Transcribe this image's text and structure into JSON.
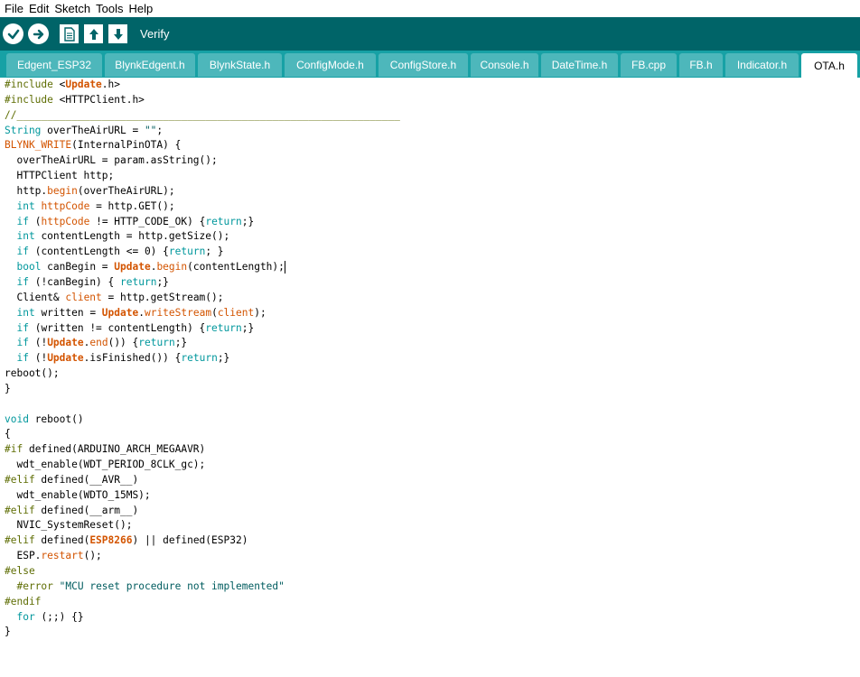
{
  "menu": [
    "File",
    "Edit",
    "Sketch",
    "Tools",
    "Help"
  ],
  "toolbar": {
    "label": "Verify",
    "buttons": [
      "verify-icon",
      "upload-icon",
      "new-icon",
      "open-icon",
      "save-icon"
    ]
  },
  "tabs": [
    "Edgent_ESP32",
    "BlynkEdgent.h",
    "BlynkState.h",
    "ConfigMode.h",
    "ConfigStore.h",
    "Console.h",
    "DateTime.h",
    "FB.cpp",
    "FB.h",
    "Indicator.h",
    "OTA.h"
  ],
  "active_tab": "OTA.h",
  "code_lines": [
    [
      [
        "pp",
        "#include "
      ],
      [
        "",
        "<"
      ],
      [
        "cls",
        "Update"
      ],
      [
        "",
        ".h>"
      ]
    ],
    [
      [
        "pp",
        "#include "
      ],
      [
        "",
        "<HTTPClient.h>"
      ]
    ],
    [
      [
        "pp",
        "//_______________________________________________________________"
      ]
    ],
    [
      [
        "kw",
        "String"
      ],
      [
        "",
        " overTheAirURL = "
      ],
      [
        "str",
        "\"\""
      ],
      [
        "",
        ";"
      ]
    ],
    [
      [
        "fn",
        "BLYNK_WRITE"
      ],
      [
        "",
        "(InternalPinOTA) {"
      ]
    ],
    [
      [
        "",
        "  overTheAirURL = param.asString();"
      ]
    ],
    [
      [
        "",
        "  HTTPClient http;"
      ]
    ],
    [
      [
        "",
        "  http."
      ],
      [
        "fn",
        "begin"
      ],
      [
        "",
        "(overTheAirURL);"
      ]
    ],
    [
      [
        "",
        "  "
      ],
      [
        "kw",
        "int"
      ],
      [
        "",
        ""
      ],
      [
        "fn",
        " httpCode"
      ],
      [
        "",
        " = http.GET();"
      ]
    ],
    [
      [
        "",
        "  "
      ],
      [
        "kw",
        "if"
      ],
      [
        "",
        " ("
      ],
      [
        "fn",
        "httpCode"
      ],
      [
        "",
        " != HTTP_CODE_OK) {"
      ],
      [
        "kw",
        "return"
      ],
      [
        "",
        ";}"
      ]
    ],
    [
      [
        "",
        "  "
      ],
      [
        "kw",
        "int"
      ],
      [
        "",
        " contentLength = http.getSize();"
      ]
    ],
    [
      [
        "",
        "  "
      ],
      [
        "kw",
        "if"
      ],
      [
        "",
        " (contentLength <= 0) {"
      ],
      [
        "kw",
        "return"
      ],
      [
        "",
        "; }"
      ]
    ],
    [
      [
        "",
        "  "
      ],
      [
        "kw",
        "bool"
      ],
      [
        "",
        " canBegin = "
      ],
      [
        "cls",
        "Update"
      ],
      [
        "",
        "."
      ],
      [
        "fn",
        "begin"
      ],
      [
        "",
        "(contentLength);"
      ],
      [
        "cur",
        ""
      ]
    ],
    [
      [
        "",
        "  "
      ],
      [
        "kw",
        "if"
      ],
      [
        "",
        " (!canBegin) { "
      ],
      [
        "kw",
        "return"
      ],
      [
        "",
        ";}"
      ]
    ],
    [
      [
        "",
        "  Client& "
      ],
      [
        "fn",
        "client"
      ],
      [
        "",
        " = http.getStream();"
      ]
    ],
    [
      [
        "",
        "  "
      ],
      [
        "kw",
        "int"
      ],
      [
        "",
        " written = "
      ],
      [
        "cls",
        "Update"
      ],
      [
        "",
        "."
      ],
      [
        "fn",
        "writeStream"
      ],
      [
        "",
        "("
      ],
      [
        "fn",
        "client"
      ],
      [
        "",
        ");"
      ]
    ],
    [
      [
        "",
        "  "
      ],
      [
        "kw",
        "if"
      ],
      [
        "",
        " (written != contentLength) {"
      ],
      [
        "kw",
        "return"
      ],
      [
        "",
        ";}"
      ]
    ],
    [
      [
        "",
        "  "
      ],
      [
        "kw",
        "if"
      ],
      [
        "",
        " (!"
      ],
      [
        "cls",
        "Update"
      ],
      [
        "",
        "."
      ],
      [
        "fn",
        "end"
      ],
      [
        "",
        "()) {"
      ],
      [
        "kw",
        "return"
      ],
      [
        "",
        ";}"
      ]
    ],
    [
      [
        "",
        "  "
      ],
      [
        "kw",
        "if"
      ],
      [
        "",
        " (!"
      ],
      [
        "cls",
        "Update"
      ],
      [
        "",
        ".isFinished()) {"
      ],
      [
        "kw",
        "return"
      ],
      [
        "",
        ";}"
      ]
    ],
    [
      [
        "",
        "reboot();"
      ]
    ],
    [
      [
        "",
        "}"
      ]
    ],
    [
      [
        "",
        ""
      ]
    ],
    [
      [
        "kw",
        "void"
      ],
      [
        "",
        " reboot()"
      ]
    ],
    [
      [
        "",
        "{"
      ]
    ],
    [
      [
        "pp",
        "#if"
      ],
      [
        "",
        " defined(ARDUINO_ARCH_MEGAAVR)"
      ]
    ],
    [
      [
        "",
        "  wdt_enable(WDT_PERIOD_8CLK_gc);"
      ]
    ],
    [
      [
        "pp",
        "#elif"
      ],
      [
        "",
        " defined(__AVR__)"
      ]
    ],
    [
      [
        "",
        "  wdt_enable(WDTO_15MS);"
      ]
    ],
    [
      [
        "pp",
        "#elif"
      ],
      [
        "",
        " defined(__arm__)"
      ]
    ],
    [
      [
        "",
        "  NVIC_SystemReset();"
      ]
    ],
    [
      [
        "pp",
        "#elif"
      ],
      [
        "",
        " defined("
      ],
      [
        "cls",
        "ESP8266"
      ],
      [
        "",
        ") || defined(ESP32)"
      ]
    ],
    [
      [
        "",
        "  ESP."
      ],
      [
        "fn",
        "restart"
      ],
      [
        "",
        "();"
      ]
    ],
    [
      [
        "pp",
        "#else"
      ]
    ],
    [
      [
        "",
        "  "
      ],
      [
        "pp",
        "#error"
      ],
      [
        "",
        " "
      ],
      [
        "str",
        "\"MCU reset procedure not implemented\""
      ]
    ],
    [
      [
        "pp",
        "#endif"
      ]
    ],
    [
      [
        "",
        "  "
      ],
      [
        "kw",
        "for"
      ],
      [
        "",
        " (;;) {}"
      ]
    ],
    [
      [
        "",
        "}"
      ]
    ]
  ]
}
